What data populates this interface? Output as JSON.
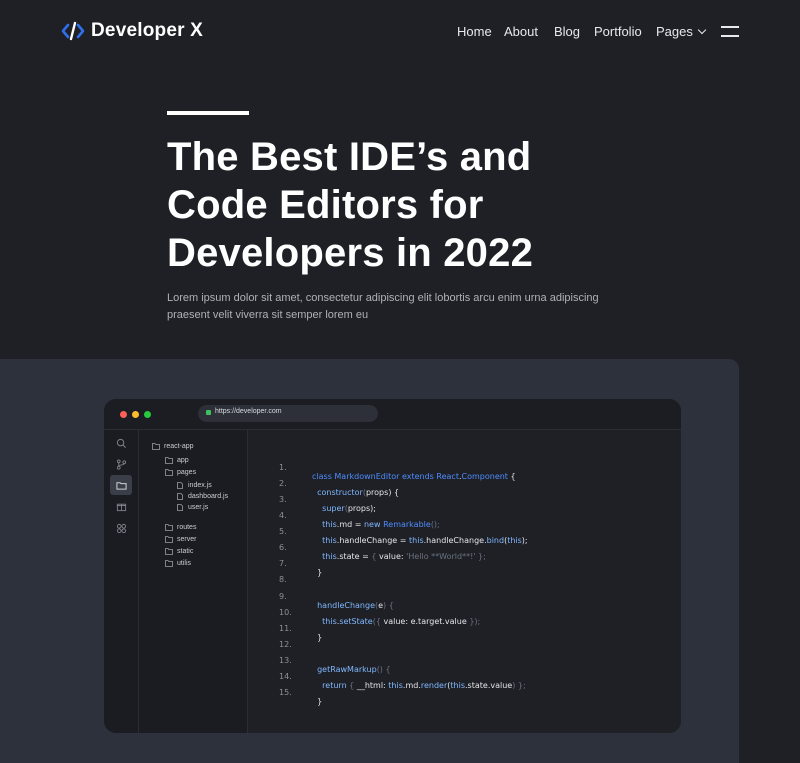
{
  "brand": {
    "name": "Developer X",
    "icon": "code-brackets-icon",
    "accent": "#2f6fec"
  },
  "nav": {
    "items": [
      {
        "label": "Home"
      },
      {
        "label": "About"
      },
      {
        "label": "Blog"
      },
      {
        "label": "Portfolio"
      },
      {
        "label": "Pages",
        "dropdown": true
      }
    ],
    "menu_icon": "hamburger-icon"
  },
  "hero": {
    "title": "The Best IDE’s and Code Editors for Developers in 2022",
    "description": "Lorem ipsum dolor sit amet, consectetur adipiscing elit lobortis arcu enim urna adipiscing praesent velit viverra sit semper lorem eu"
  },
  "editor": {
    "url": "https://developer.com",
    "traffic_lights": [
      "#ff5f56",
      "#ffbd2e",
      "#27c93f"
    ],
    "activity_icons": [
      "search-icon",
      "git-branch-icon",
      "folder-icon",
      "extensions-icon",
      "grid-icon"
    ],
    "tree": [
      {
        "label": "react-app",
        "type": "folder"
      },
      {
        "label": "app",
        "type": "folder"
      },
      {
        "label": "pages",
        "type": "folder"
      },
      {
        "label": "index.js",
        "type": "file"
      },
      {
        "label": "dashboard.js",
        "type": "file"
      },
      {
        "label": "user.js",
        "type": "file"
      },
      {
        "label": "routes",
        "type": "folder"
      },
      {
        "label": "server",
        "type": "folder"
      },
      {
        "label": "static",
        "type": "folder"
      },
      {
        "label": "utilis",
        "type": "folder"
      }
    ],
    "line_numbers": [
      "1.",
      "2.",
      "3.",
      "4.",
      "5.",
      "6.",
      "7.",
      "8.",
      "9.",
      "10.",
      "11.",
      "12.",
      "13.",
      "14.",
      "15."
    ],
    "code": {
      "l1": {
        "a": "class",
        "b": "MarkdownEditor",
        "c": "extends",
        "d": "React",
        "e": ".",
        "f": "Component",
        "g": " {"
      },
      "l2": {
        "a": "constructor",
        "b": "(",
        "c": "props",
        "d": ") {"
      },
      "l3": {
        "a": "super",
        "b": "(",
        "c": "props",
        "d": ");"
      },
      "l4": {
        "a": "this",
        "b": ".md = ",
        "c": "new",
        "d": "Remarkable",
        "e": "();"
      },
      "l5": {
        "a": "this",
        "b": ".handleChange = ",
        "c": "this",
        "d": ".handleChange.",
        "e": "bind",
        "f": "(",
        "g": "this",
        "h": ");"
      },
      "l6": {
        "a": "this",
        "b": ".state = ",
        "c": "{ ",
        "d": "value: ",
        "e": "'Hello **World**!'",
        "f": " };"
      },
      "l7": {
        "a": "}"
      },
      "l9": {
        "a": "handleChange",
        "b": "(",
        "c": "e",
        "d": ") {"
      },
      "l10": {
        "a": "this",
        "b": ".",
        "c": "setState",
        "d": "({ ",
        "e": "value: e.target.value",
        "f": " });"
      },
      "l11": {
        "a": "}"
      },
      "l13": {
        "a": "getRawMarkup",
        "b": "() {"
      },
      "l14": {
        "a": "return",
        "b": " { ",
        "c": "__html: ",
        "d": "this",
        "e": ".md.",
        "f": "render",
        "g": "(",
        "h": "this",
        "i": ".state.value",
        "j": ") };"
      },
      "l15": {
        "a": "}"
      }
    }
  }
}
